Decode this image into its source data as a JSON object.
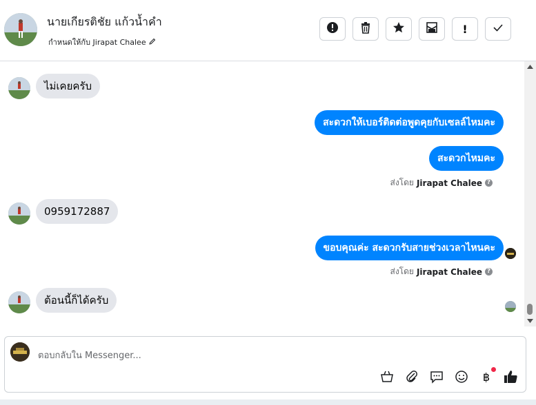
{
  "header": {
    "contact_name": "นายเกียรติชัย แก้วน้ำคำ",
    "assigned_to": "กำหนดให้กับ Jirapat Chalee"
  },
  "toolbar": {
    "mark_spam_label": "!",
    "icons": [
      "alert-circle-icon",
      "trash-icon",
      "star-icon",
      "mark-unread-icon",
      "exclamation-icon",
      "check-icon"
    ]
  },
  "messages": [
    {
      "direction": "in",
      "text": "ไม่เคยครับ"
    },
    {
      "direction": "out",
      "text": "สะดวกให้เบอร์ติดต่อพูดคุยกับเซลล์ไหมคะ"
    },
    {
      "direction": "out",
      "text": "สะดวกไหมคะ"
    },
    {
      "direction": "in",
      "text": "0959172887"
    },
    {
      "direction": "out",
      "text": "ขอบคุณค่ะ สะดวกรับสายช่วงเวลาไหนคะ"
    },
    {
      "direction": "in",
      "text": "ต้อนนี้ก็ได้ครับ"
    }
  ],
  "sent_by": {
    "prefix": "ส่งโดย",
    "name": "Jirapat Chalee",
    "help": "?"
  },
  "composer": {
    "placeholder": "ตอบกลับใน Messenger...",
    "currency_symbol": "฿"
  },
  "colors": {
    "outgoing_bubble": "#0084ff",
    "incoming_bubble": "#e4e6eb",
    "notification_dot": "#f02849"
  }
}
